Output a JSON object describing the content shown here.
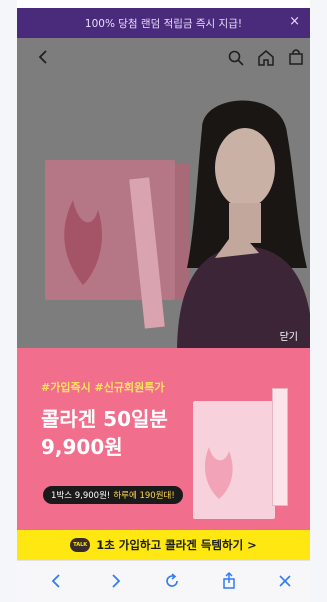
{
  "promo_banner": {
    "text": "100% 당첨 랜덤 적립금 즉시 지급!",
    "close_glyph": "×"
  },
  "header": {
    "icons": [
      "back-icon",
      "search-icon",
      "home-icon",
      "shopping-bag-icon"
    ]
  },
  "hero": {
    "close_label": "닫기"
  },
  "promotion": {
    "tags": "#가입즉시 #신규회원특가",
    "headline_line1": "콜라겐 50일분",
    "headline_line2": "9,900원",
    "pill_text": "1박스 9,900원!",
    "pill_highlight": "하루에 190원대!"
  },
  "kakao_bar": {
    "talk_badge": "TALK",
    "text": "1초 가입하고 콜라겐 득템하기 >"
  },
  "browser_toolbar": {
    "icons": [
      "back-icon",
      "forward-icon",
      "reload-icon",
      "share-icon",
      "close-icon"
    ]
  },
  "colors": {
    "promo_bg": "#4a2a7a",
    "pink_bg": "#f26e8d",
    "kakao_bg": "#ffe812",
    "tag_yellow": "#ffe45c",
    "browser_icon_blue": "#2f7cf6"
  }
}
